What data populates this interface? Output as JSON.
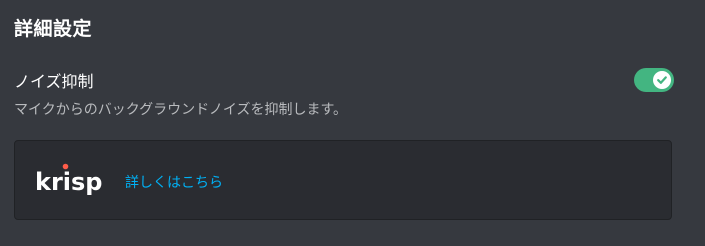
{
  "section": {
    "title": "詳細設定"
  },
  "noise_suppression": {
    "label": "ノイズ抑制",
    "description": "マイクからのバックグラウンドノイズを抑制します。",
    "enabled": true,
    "toggle_color": "#43b581"
  },
  "krisp": {
    "logo_text": "krisp",
    "logo_dot_color": "#ff5c49",
    "link_text": "詳しくはこちら",
    "link_color": "#00b0f4"
  }
}
